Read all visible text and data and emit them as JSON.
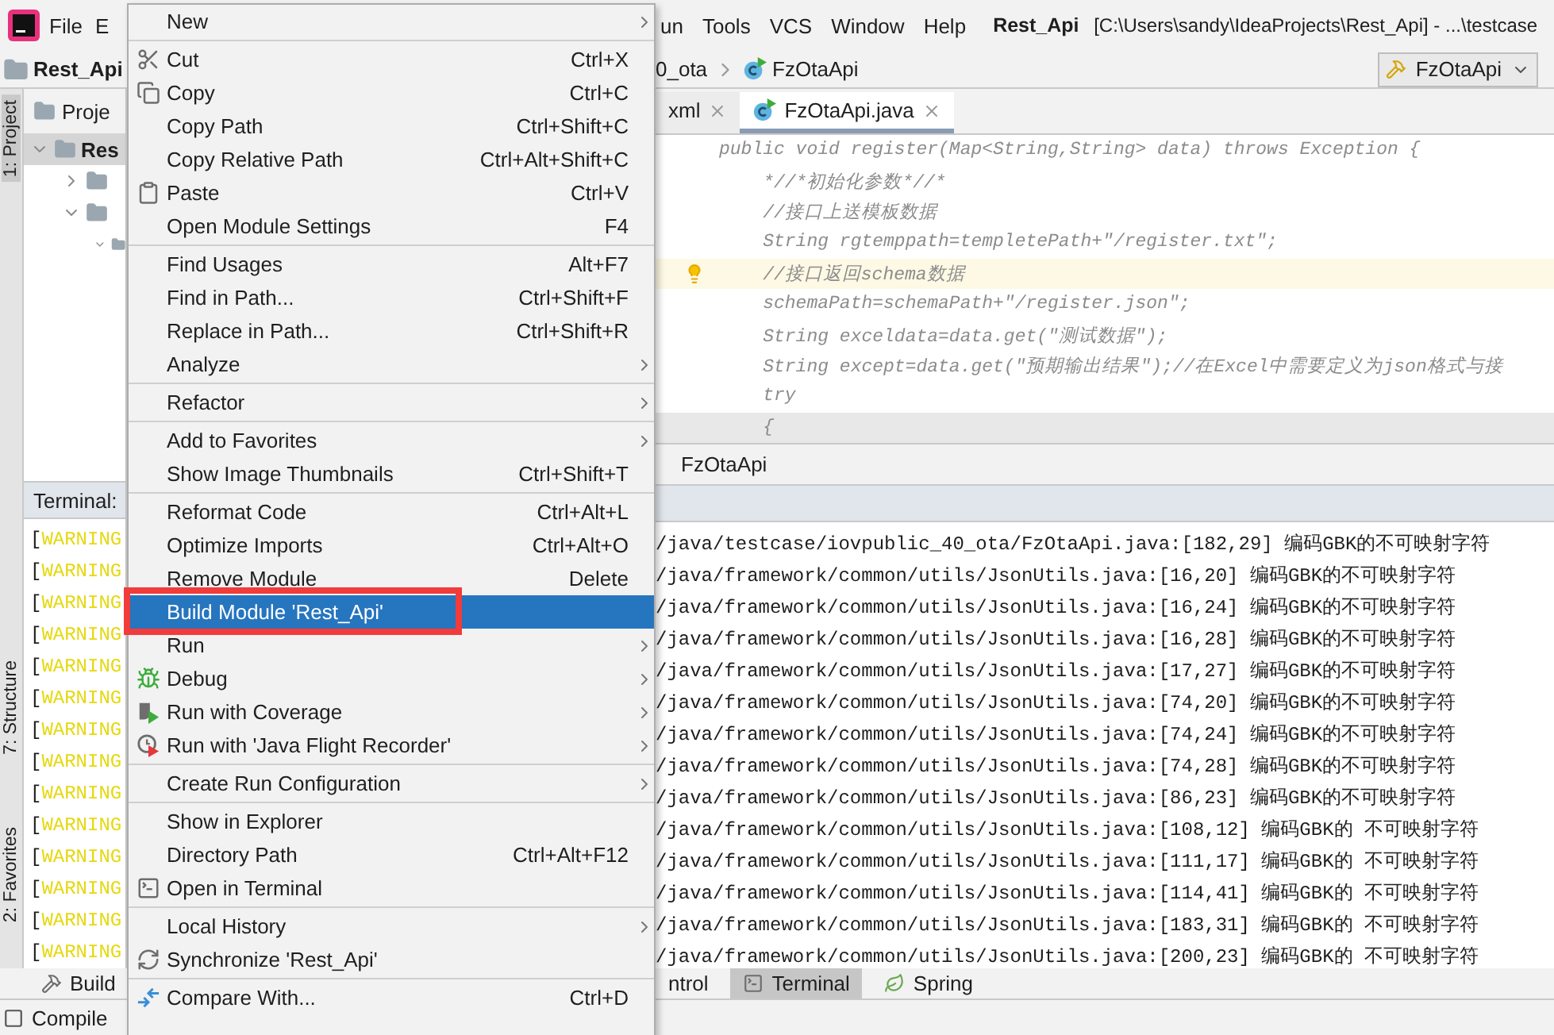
{
  "menubar": {
    "left": [
      "File",
      "E"
    ],
    "right": [
      "un",
      "Tools",
      "VCS",
      "Window",
      "Help"
    ],
    "title_bold": "Rest_Api",
    "title_path": "[C:\\Users\\sandy\\IdeaProjects\\Rest_Api] - ...\\testcase"
  },
  "navbar": {
    "project": "Rest_Api",
    "crumbs": [
      "0_ota",
      "FzOtaApi"
    ],
    "run_config": "FzOtaApi"
  },
  "side_strip": [
    {
      "label": "1: Project",
      "selected": true
    },
    {
      "label": "7: Structure",
      "selected": false
    },
    {
      "label": "2: Favorites",
      "selected": false
    }
  ],
  "project_panel": {
    "header": "Proje",
    "tree": [
      {
        "label": "Res",
        "selected": true,
        "expanded": true,
        "children": [
          {
            "expanded": false
          },
          {
            "expanded": true,
            "children": [
              {
                "expanded": true
              }
            ]
          }
        ]
      }
    ]
  },
  "editor": {
    "tabs": [
      {
        "label": "xml",
        "selected": false
      },
      {
        "label": "FzOtaApi.java",
        "selected": true
      }
    ],
    "lines": [
      {
        "text": "public void register(Map<String,String> data) throws Exception {",
        "kind": "plain"
      },
      {
        "text": "    *//*初始化参数*//*",
        "kind": "plain"
      },
      {
        "text": "    //接口上送模板数据",
        "kind": "plain"
      },
      {
        "text": "    String rgtemppath=templetePath+\"/register.txt\";",
        "kind": "plain"
      },
      {
        "text": "    //接口返回schema数据",
        "kind": "hint"
      },
      {
        "text": "    schemaPath=schemaPath+\"/register.json\";",
        "kind": "plain"
      },
      {
        "text": "    String exceldata=data.get(\"测试数据\");",
        "kind": "plain"
      },
      {
        "text": "    String except=data.get(\"预期输出结果\");//在Excel中需要定义为json格式与接",
        "kind": "plain"
      },
      {
        "text": "    try",
        "kind": "plain"
      },
      {
        "text": "    {",
        "kind": "caret"
      }
    ],
    "breadcrumb": "FzOtaApi"
  },
  "terminal": {
    "title": "Terminal:",
    "lines": [
      {
        "bracket": "[",
        "tag": "WARNING",
        "text": "/java/testcase/iovpublic_40_ota/FzOtaApi.java:[182,29] 编码GBK的不可映射字符"
      },
      {
        "bracket": "[",
        "tag": "WARNING",
        "text": "/java/framework/common/utils/JsonUtils.java:[16,20] 编码GBK的不可映射字符"
      },
      {
        "bracket": "[",
        "tag": "WARNING",
        "text": "/java/framework/common/utils/JsonUtils.java:[16,24] 编码GBK的不可映射字符"
      },
      {
        "bracket": "[",
        "tag": "WARNING",
        "text": "/java/framework/common/utils/JsonUtils.java:[16,28] 编码GBK的不可映射字符"
      },
      {
        "bracket": "[",
        "tag": "WARNING",
        "text": "/java/framework/common/utils/JsonUtils.java:[17,27] 编码GBK的不可映射字符"
      },
      {
        "bracket": "[",
        "tag": "WARNING",
        "text": "/java/framework/common/utils/JsonUtils.java:[74,20] 编码GBK的不可映射字符"
      },
      {
        "bracket": "[",
        "tag": "WARNING",
        "text": "/java/framework/common/utils/JsonUtils.java:[74,24] 编码GBK的不可映射字符"
      },
      {
        "bracket": "[",
        "tag": "WARNING",
        "text": "/java/framework/common/utils/JsonUtils.java:[74,28] 编码GBK的不可映射字符"
      },
      {
        "bracket": "[",
        "tag": "WARNING",
        "text": "/java/framework/common/utils/JsonUtils.java:[86,23] 编码GBK的不可映射字符"
      },
      {
        "bracket": "[",
        "tag": "WARNING",
        "text": "/java/framework/common/utils/JsonUtils.java:[108,12] 编码GBK的 不可映射字符"
      },
      {
        "bracket": "[",
        "tag": "WARNING",
        "text": "/java/framework/common/utils/JsonUtils.java:[111,17] 编码GBK的 不可映射字符"
      },
      {
        "bracket": "[",
        "tag": "WARNING",
        "text": "/java/framework/common/utils/JsonUtils.java:[114,41] 编码GBK的 不可映射字符"
      },
      {
        "bracket": "[",
        "tag": "WARNING",
        "text": "/java/framework/common/utils/JsonUtils.java:[183,31] 编码GBK的 不可映射字符"
      },
      {
        "bracket": "[",
        "tag": "WARNING",
        "text": "/java/framework/common/utils/JsonUtils.java:[200,23] 编码GBK的 不可映射字符"
      }
    ]
  },
  "tool_tabs": {
    "left": [
      {
        "label": "Build",
        "selected": false
      }
    ],
    "right": [
      {
        "label": "ntrol",
        "selected": false
      },
      {
        "label": "Terminal",
        "selected": true
      },
      {
        "label": "Spring",
        "selected": false
      }
    ]
  },
  "status_bar": {
    "text": "Compile"
  },
  "context_menu": {
    "groups": [
      [
        {
          "label": "New",
          "submenu": true,
          "selected": false
        }
      ],
      [
        {
          "label": "Cut",
          "shortcut": "Ctrl+X",
          "submenu": false,
          "selected": false
        },
        {
          "label": "Copy",
          "shortcut": "Ctrl+C",
          "submenu": false,
          "selected": false
        },
        {
          "label": "Copy Path",
          "shortcut": "Ctrl+Shift+C",
          "submenu": false,
          "selected": false
        },
        {
          "label": "Copy Relative Path",
          "shortcut": "Ctrl+Alt+Shift+C",
          "submenu": false,
          "selected": false
        },
        {
          "label": "Paste",
          "shortcut": "Ctrl+V",
          "submenu": false,
          "selected": false
        },
        {
          "label": "Open Module Settings",
          "shortcut": "F4",
          "submenu": false,
          "selected": false
        }
      ],
      [
        {
          "label": "Find Usages",
          "shortcut": "Alt+F7",
          "submenu": false,
          "selected": false
        },
        {
          "label": "Find in Path...",
          "shortcut": "Ctrl+Shift+F",
          "submenu": false,
          "selected": false
        },
        {
          "label": "Replace in Path...",
          "shortcut": "Ctrl+Shift+R",
          "submenu": false,
          "selected": false
        },
        {
          "label": "Analyze",
          "submenu": true,
          "selected": false
        }
      ],
      [
        {
          "label": "Refactor",
          "submenu": true,
          "selected": false
        }
      ],
      [
        {
          "label": "Add to Favorites",
          "submenu": true,
          "selected": false
        },
        {
          "label": "Show Image Thumbnails",
          "shortcut": "Ctrl+Shift+T",
          "submenu": false,
          "selected": false
        }
      ],
      [
        {
          "label": "Reformat Code",
          "shortcut": "Ctrl+Alt+L",
          "submenu": false,
          "selected": false
        },
        {
          "label": "Optimize Imports",
          "shortcut": "Ctrl+Alt+O",
          "submenu": false,
          "selected": false
        },
        {
          "label": "Remove Module",
          "shortcut": "Delete",
          "submenu": false,
          "selected": false
        },
        {
          "label": "Build Module 'Rest_Api'",
          "submenu": false,
          "selected": true
        },
        {
          "label": "Run",
          "submenu": true,
          "selected": false
        },
        {
          "label": "Debug",
          "submenu": true,
          "selected": false
        },
        {
          "label": "Run with Coverage",
          "submenu": true,
          "selected": false
        },
        {
          "label": "Run with 'Java Flight Recorder'",
          "submenu": true,
          "selected": false
        }
      ],
      [
        {
          "label": "Create Run Configuration",
          "submenu": true,
          "selected": false
        }
      ],
      [
        {
          "label": "Show in Explorer",
          "submenu": false,
          "selected": false
        },
        {
          "label": "Directory Path",
          "shortcut": "Ctrl+Alt+F12",
          "submenu": false,
          "selected": false
        },
        {
          "label": "Open in Terminal",
          "submenu": false,
          "selected": false
        }
      ],
      [
        {
          "label": "Local History",
          "submenu": true,
          "selected": false
        },
        {
          "label": "Synchronize 'Rest_Api'",
          "submenu": false,
          "selected": false
        }
      ],
      [
        {
          "label": "Compare With...",
          "shortcut": "Ctrl+D",
          "submenu": false,
          "selected": false
        }
      ]
    ]
  }
}
